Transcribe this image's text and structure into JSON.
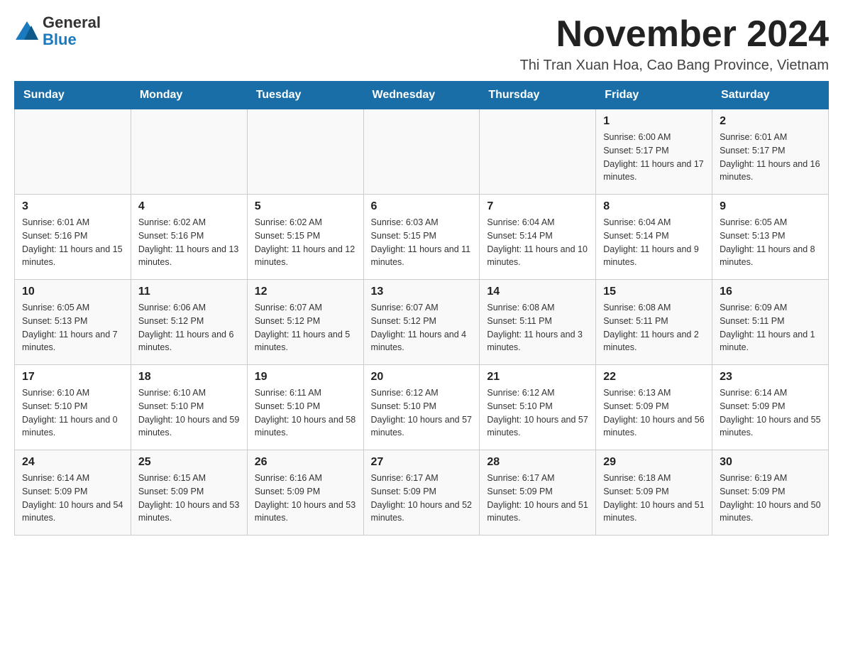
{
  "header": {
    "logo_general": "General",
    "logo_blue": "Blue",
    "month_title": "November 2024",
    "location": "Thi Tran Xuan Hoa, Cao Bang Province, Vietnam"
  },
  "days_of_week": [
    "Sunday",
    "Monday",
    "Tuesday",
    "Wednesday",
    "Thursday",
    "Friday",
    "Saturday"
  ],
  "weeks": [
    [
      {
        "day": "",
        "info": ""
      },
      {
        "day": "",
        "info": ""
      },
      {
        "day": "",
        "info": ""
      },
      {
        "day": "",
        "info": ""
      },
      {
        "day": "",
        "info": ""
      },
      {
        "day": "1",
        "info": "Sunrise: 6:00 AM\nSunset: 5:17 PM\nDaylight: 11 hours and 17 minutes."
      },
      {
        "day": "2",
        "info": "Sunrise: 6:01 AM\nSunset: 5:17 PM\nDaylight: 11 hours and 16 minutes."
      }
    ],
    [
      {
        "day": "3",
        "info": "Sunrise: 6:01 AM\nSunset: 5:16 PM\nDaylight: 11 hours and 15 minutes."
      },
      {
        "day": "4",
        "info": "Sunrise: 6:02 AM\nSunset: 5:16 PM\nDaylight: 11 hours and 13 minutes."
      },
      {
        "day": "5",
        "info": "Sunrise: 6:02 AM\nSunset: 5:15 PM\nDaylight: 11 hours and 12 minutes."
      },
      {
        "day": "6",
        "info": "Sunrise: 6:03 AM\nSunset: 5:15 PM\nDaylight: 11 hours and 11 minutes."
      },
      {
        "day": "7",
        "info": "Sunrise: 6:04 AM\nSunset: 5:14 PM\nDaylight: 11 hours and 10 minutes."
      },
      {
        "day": "8",
        "info": "Sunrise: 6:04 AM\nSunset: 5:14 PM\nDaylight: 11 hours and 9 minutes."
      },
      {
        "day": "9",
        "info": "Sunrise: 6:05 AM\nSunset: 5:13 PM\nDaylight: 11 hours and 8 minutes."
      }
    ],
    [
      {
        "day": "10",
        "info": "Sunrise: 6:05 AM\nSunset: 5:13 PM\nDaylight: 11 hours and 7 minutes."
      },
      {
        "day": "11",
        "info": "Sunrise: 6:06 AM\nSunset: 5:12 PM\nDaylight: 11 hours and 6 minutes."
      },
      {
        "day": "12",
        "info": "Sunrise: 6:07 AM\nSunset: 5:12 PM\nDaylight: 11 hours and 5 minutes."
      },
      {
        "day": "13",
        "info": "Sunrise: 6:07 AM\nSunset: 5:12 PM\nDaylight: 11 hours and 4 minutes."
      },
      {
        "day": "14",
        "info": "Sunrise: 6:08 AM\nSunset: 5:11 PM\nDaylight: 11 hours and 3 minutes."
      },
      {
        "day": "15",
        "info": "Sunrise: 6:08 AM\nSunset: 5:11 PM\nDaylight: 11 hours and 2 minutes."
      },
      {
        "day": "16",
        "info": "Sunrise: 6:09 AM\nSunset: 5:11 PM\nDaylight: 11 hours and 1 minute."
      }
    ],
    [
      {
        "day": "17",
        "info": "Sunrise: 6:10 AM\nSunset: 5:10 PM\nDaylight: 11 hours and 0 minutes."
      },
      {
        "day": "18",
        "info": "Sunrise: 6:10 AM\nSunset: 5:10 PM\nDaylight: 10 hours and 59 minutes."
      },
      {
        "day": "19",
        "info": "Sunrise: 6:11 AM\nSunset: 5:10 PM\nDaylight: 10 hours and 58 minutes."
      },
      {
        "day": "20",
        "info": "Sunrise: 6:12 AM\nSunset: 5:10 PM\nDaylight: 10 hours and 57 minutes."
      },
      {
        "day": "21",
        "info": "Sunrise: 6:12 AM\nSunset: 5:10 PM\nDaylight: 10 hours and 57 minutes."
      },
      {
        "day": "22",
        "info": "Sunrise: 6:13 AM\nSunset: 5:09 PM\nDaylight: 10 hours and 56 minutes."
      },
      {
        "day": "23",
        "info": "Sunrise: 6:14 AM\nSunset: 5:09 PM\nDaylight: 10 hours and 55 minutes."
      }
    ],
    [
      {
        "day": "24",
        "info": "Sunrise: 6:14 AM\nSunset: 5:09 PM\nDaylight: 10 hours and 54 minutes."
      },
      {
        "day": "25",
        "info": "Sunrise: 6:15 AM\nSunset: 5:09 PM\nDaylight: 10 hours and 53 minutes."
      },
      {
        "day": "26",
        "info": "Sunrise: 6:16 AM\nSunset: 5:09 PM\nDaylight: 10 hours and 53 minutes."
      },
      {
        "day": "27",
        "info": "Sunrise: 6:17 AM\nSunset: 5:09 PM\nDaylight: 10 hours and 52 minutes."
      },
      {
        "day": "28",
        "info": "Sunrise: 6:17 AM\nSunset: 5:09 PM\nDaylight: 10 hours and 51 minutes."
      },
      {
        "day": "29",
        "info": "Sunrise: 6:18 AM\nSunset: 5:09 PM\nDaylight: 10 hours and 51 minutes."
      },
      {
        "day": "30",
        "info": "Sunrise: 6:19 AM\nSunset: 5:09 PM\nDaylight: 10 hours and 50 minutes."
      }
    ]
  ]
}
